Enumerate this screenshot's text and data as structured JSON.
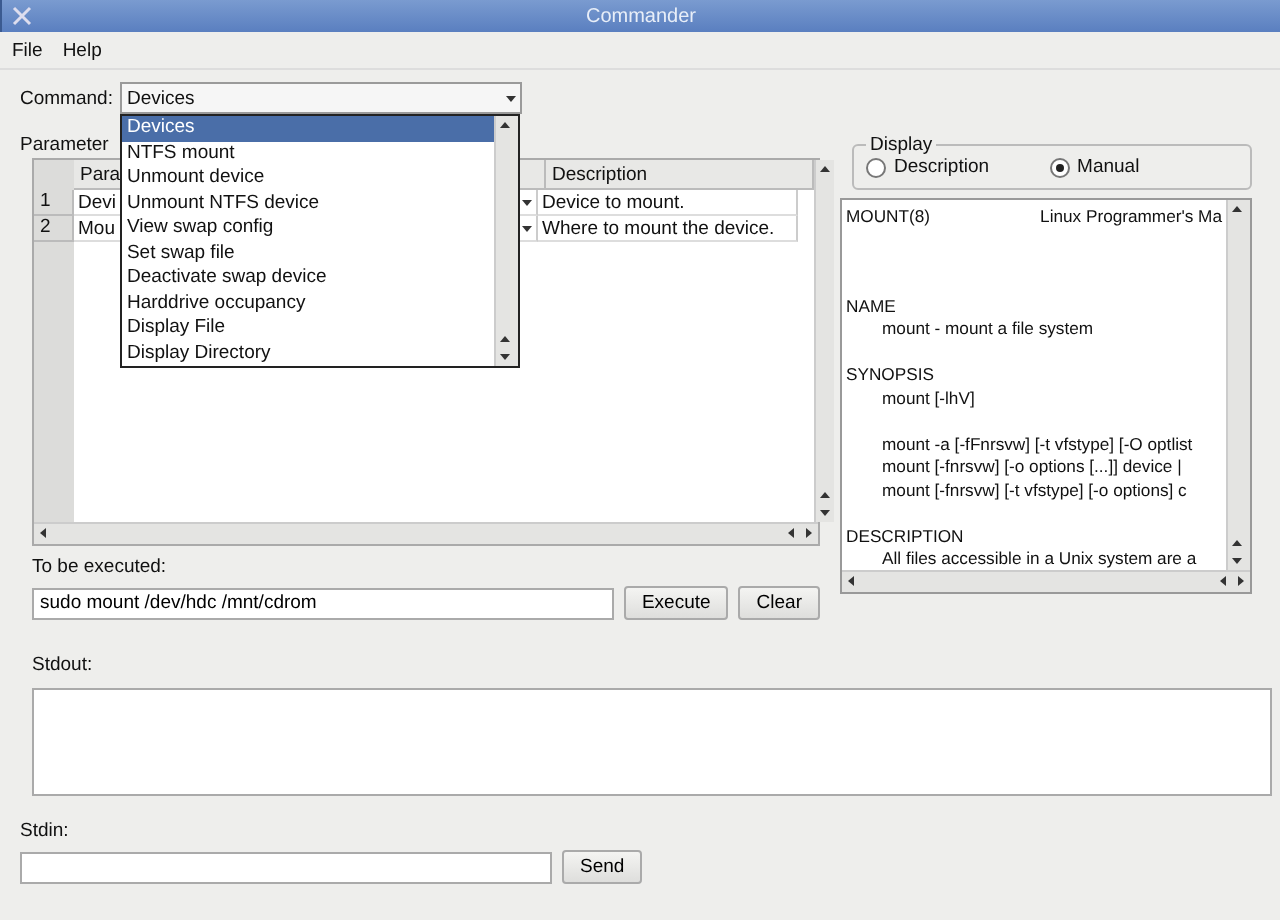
{
  "window": {
    "title": "Commander"
  },
  "menu": [
    {
      "label": "File"
    },
    {
      "label": "Help"
    }
  ],
  "command": {
    "label": "Command:",
    "value": "Devices",
    "expanded": true,
    "options": [
      {
        "label": "Devices",
        "selected": true
      },
      {
        "label": "NTFS mount",
        "selected": false
      },
      {
        "label": "Unmount device",
        "selected": false
      },
      {
        "label": "Unmount NTFS device",
        "selected": false
      },
      {
        "label": "View swap config",
        "selected": false
      },
      {
        "label": "Set swap file",
        "selected": false
      },
      {
        "label": "Deactivate swap device",
        "selected": false
      },
      {
        "label": "Harddrive occupancy",
        "selected": false
      },
      {
        "label": "Display File",
        "selected": false
      },
      {
        "label": "Display Directory",
        "selected": false
      }
    ]
  },
  "parameters": {
    "label": "Parameter",
    "columns": [
      "Para",
      "Description"
    ],
    "rows": [
      {
        "number": "1",
        "parameter": "Devi",
        "description": "Device to mount."
      },
      {
        "number": "2",
        "parameter": "Mou",
        "description": "Where to mount the device."
      }
    ]
  },
  "execute": {
    "label": "To be executed:",
    "value": "sudo mount /dev/hdc /mnt/cdrom",
    "buttons": [
      "Execute",
      "Clear"
    ]
  },
  "display": {
    "title": "Display",
    "options": [
      {
        "label": "Description",
        "selected": false
      },
      {
        "label": "Manual",
        "selected": true
      }
    ]
  },
  "manual": {
    "header_left": "MOUNT(8)",
    "header_right": "Linux Programmer's Ma",
    "lines": [
      {
        "text": "NAME",
        "indented": false,
        "space_before": true
      },
      {
        "text": "mount - mount a file system",
        "indented": true,
        "space_before": false
      },
      {
        "text": "SYNOPSIS",
        "indented": false,
        "space_before": true
      },
      {
        "text": "mount [-lhV]",
        "indented": true,
        "space_before": false
      },
      {
        "text": "mount -a [-fFnrsvw] [-t vfstype] [-O optlist",
        "indented": true,
        "space_before": true
      },
      {
        "text": "mount [-fnrsvw] [-o options [...]] device |",
        "indented": true,
        "space_before": false
      },
      {
        "text": "mount [-fnrsvw] [-t vfstype] [-o options] c",
        "indented": true,
        "space_before": false
      },
      {
        "text": "DESCRIPTION",
        "indented": false,
        "space_before": true
      },
      {
        "text": "All files accessible in a Unix system are a",
        "indented": true,
        "space_before": false
      }
    ]
  },
  "stdout": {
    "label": "Stdout:"
  },
  "stdin": {
    "label": "Stdin:",
    "button": "Send"
  }
}
